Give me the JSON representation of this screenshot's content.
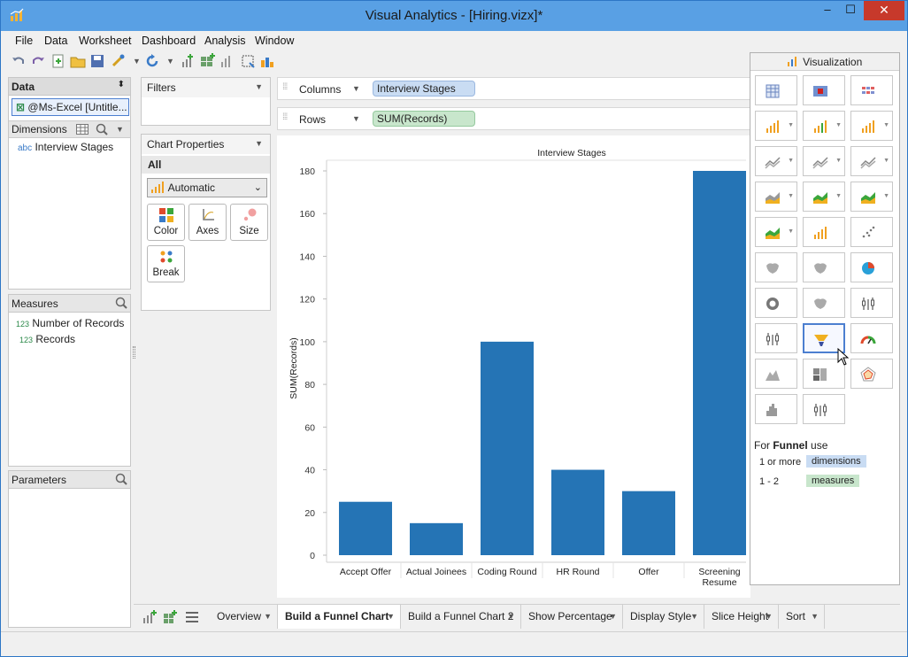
{
  "window": {
    "title": "Visual Analytics - [Hiring.vizx]*"
  },
  "menu": [
    "File",
    "Data",
    "Worksheet",
    "Dashboard",
    "Analysis",
    "Window"
  ],
  "data_panel": {
    "header": "Data",
    "source": "@Ms-Excel [Untitle...",
    "dimensions_label": "Dimensions",
    "dimensions": [
      {
        "type": "abc",
        "name": "Interview Stages"
      }
    ],
    "measures_label": "Measures",
    "measures": [
      {
        "type": "123",
        "name": "Number of Records"
      },
      {
        "type": "123",
        "name": "Records"
      }
    ],
    "parameters_label": "Parameters"
  },
  "filters": {
    "label": "Filters"
  },
  "chart_properties": {
    "label": "Chart Properties",
    "scope": "All",
    "mark_type": "Automatic",
    "buttons": [
      "Color",
      "Axes",
      "Size",
      "Break"
    ]
  },
  "shelves": {
    "columns_label": "Columns",
    "columns_pill": "Interview Stages",
    "rows_label": "Rows",
    "rows_pill": "SUM(Records)"
  },
  "chart_data": {
    "type": "bar",
    "title": "Interview Stages",
    "ylabel": "SUM(Records)",
    "xlabel": "",
    "categories": [
      "Accept Offer",
      "Actual Joinees",
      "Coding Round",
      "HR Round",
      "Offer",
      "Screening Resume"
    ],
    "values": [
      25,
      15,
      100,
      40,
      30,
      180
    ],
    "ylim": [
      0,
      180
    ],
    "yticks": [
      0,
      20,
      40,
      60,
      80,
      100,
      120,
      140,
      160,
      180
    ],
    "bar_color": "#2574b5",
    "grid": false
  },
  "visualization": {
    "header": "Visualization",
    "hint_prefix": "For",
    "hint_chart": "Funnel",
    "hint_suffix": "use",
    "req1_count": "1 or more",
    "req1_kind": "dimensions",
    "req2_count": "1 - 2",
    "req2_kind": "measures"
  },
  "tabs": [
    "Overview",
    "Build a Funnel Chart",
    "Build a Funnel Chart 2",
    "Show Percentage",
    "Display Style",
    "Slice Height",
    "Sort"
  ],
  "active_tab": "Build a Funnel Chart"
}
